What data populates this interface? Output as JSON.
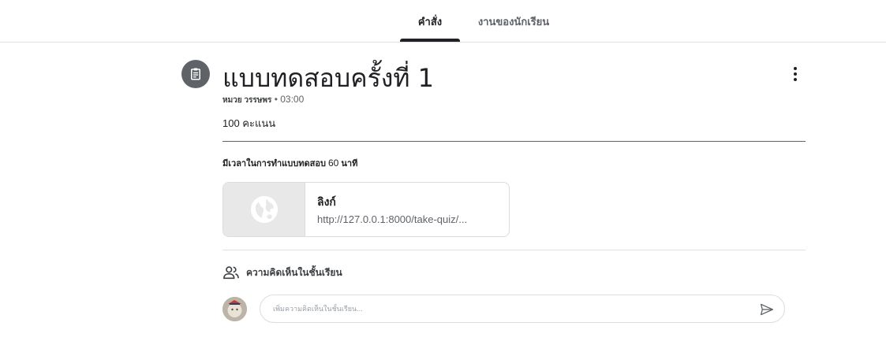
{
  "tabs": {
    "instructions": "คำสั่ง",
    "student_work": "งานของนักเรียน"
  },
  "assignment": {
    "title": "แบบทดสอบครั้งที่ 1",
    "author": "หมวย วรรษพร",
    "separator": "•",
    "time": "03:00",
    "points": "100 คะแนน",
    "description_prefix": "มีเวลาในการทำแบบทดสอบ",
    "description_number": "60",
    "description_suffix": "นาที"
  },
  "attachment": {
    "title": "ลิงก์",
    "url": "http://127.0.0.1:8000/take-quiz/..."
  },
  "comments": {
    "header": "ความคิดเห็นในชั้นเรียน",
    "placeholder": "เพิ่มความคิดเห็นในชั้นเรียน..."
  },
  "icons": {
    "assignment": "assignment-icon",
    "more": "more-vert-icon",
    "link_thumb": "globe-icon",
    "comments": "people-icon",
    "send": "send-icon"
  }
}
